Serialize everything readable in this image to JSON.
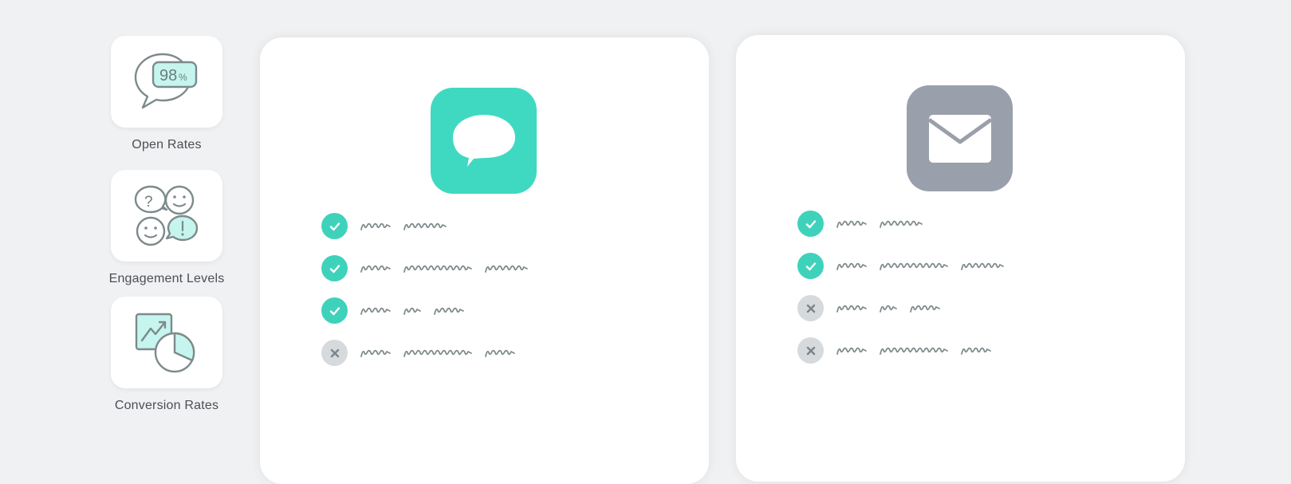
{
  "colors": {
    "background": "#f0f1f3",
    "accent_teal": "#3fd9c1",
    "neutral_gray": "#9aa0ab",
    "check_bg": "#3fd2bb",
    "cross_bg": "#d6dadd",
    "icon_stroke": "#7d8a8c",
    "icon_fill_light": "#c5f5ee"
  },
  "metrics": [
    {
      "id": "open-rates",
      "label": "Open Rates",
      "icon": "speech-bubble-percent-icon",
      "icon_value": "98",
      "icon_unit": "%"
    },
    {
      "id": "engagement-levels",
      "label": "Engagement Levels",
      "icon": "chat-faces-icon"
    },
    {
      "id": "conversion-rates",
      "label": "Conversion Rates",
      "icon": "chart-pie-icon"
    }
  ],
  "cards": [
    {
      "id": "sms",
      "icon": "message-bubble-icon",
      "features": [
        {
          "status": "check",
          "words": [
            4,
            6
          ]
        },
        {
          "status": "check",
          "words": [
            4,
            10,
            6
          ]
        },
        {
          "status": "check",
          "words": [
            4,
            2,
            4
          ]
        },
        {
          "status": "cross",
          "words": [
            4,
            10,
            4
          ]
        }
      ]
    },
    {
      "id": "email",
      "icon": "envelope-icon",
      "features": [
        {
          "status": "check",
          "words": [
            4,
            6
          ]
        },
        {
          "status": "check",
          "words": [
            4,
            10,
            6
          ]
        },
        {
          "status": "cross",
          "words": [
            4,
            2,
            4
          ]
        },
        {
          "status": "cross",
          "words": [
            4,
            10,
            4
          ]
        }
      ]
    }
  ]
}
